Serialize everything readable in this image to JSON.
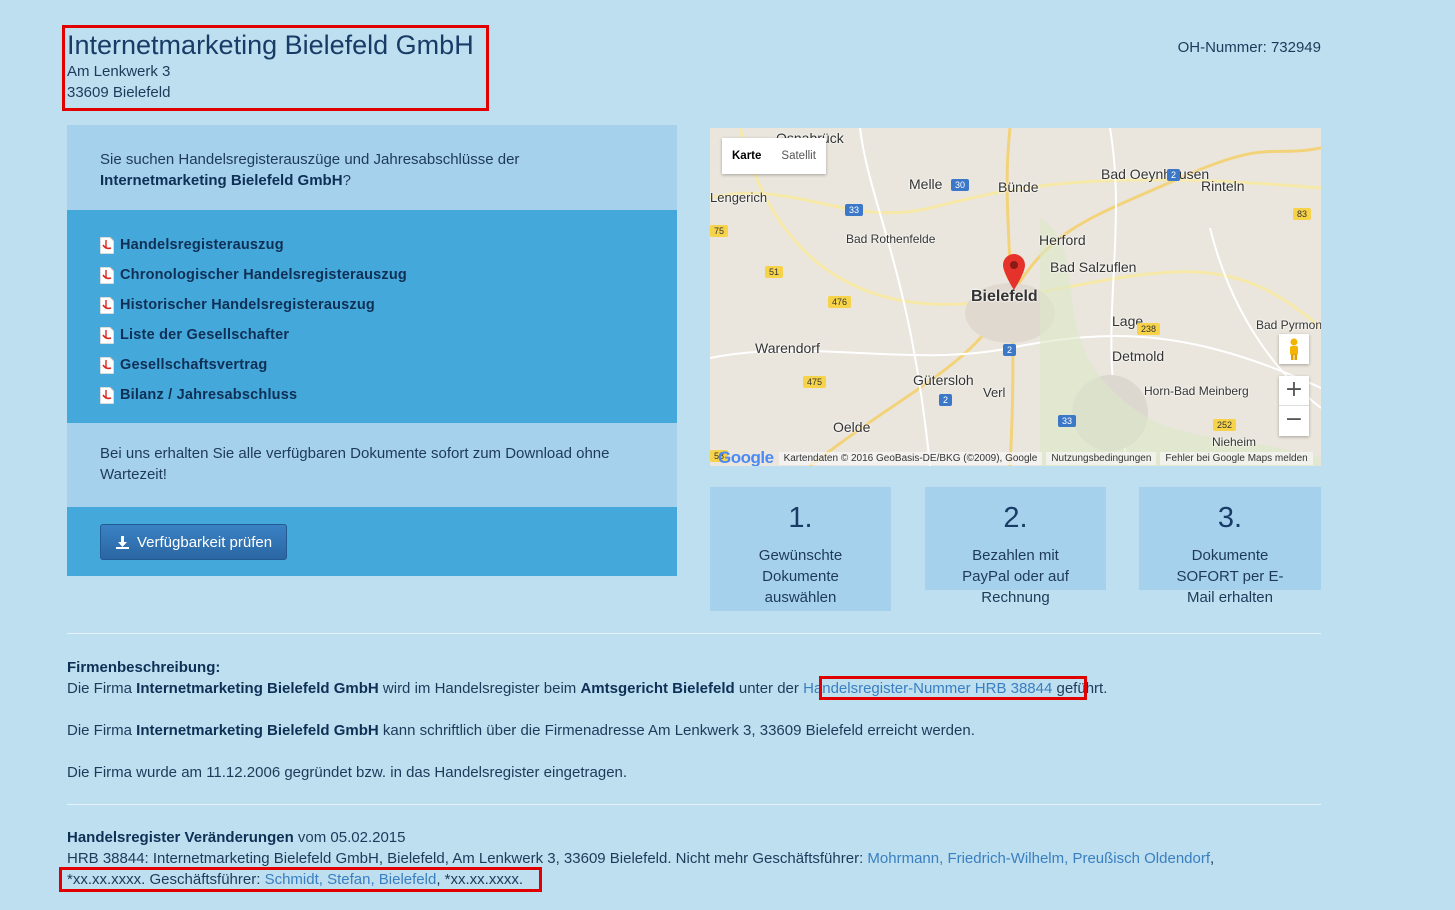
{
  "company": {
    "name": "Internetmarketing Bielefeld GmbH",
    "street": "Am Lenkwerk 3",
    "city": "33609 Bielefeld"
  },
  "oh_number": "OH-Nummer: 732949",
  "left_panel": {
    "intro_prefix": "Sie suchen Handelsregisterauszüge und Jahresabschlüsse der",
    "intro_company": "Internetmarketing Bielefeld GmbH",
    "intro_suffix": "?",
    "documents": [
      "Handelsregisterauszug",
      "Chronologischer Handelsregisterauszug",
      "Historischer Handelsregisterauszug",
      "Liste der Gesellschafter",
      "Gesellschaftsvertrag",
      "Bilanz / Jahresabschluss"
    ],
    "note": "Bei uns erhalten Sie alle verfügbaren Dokumente sofort zum Download ohne Wartezeit!",
    "button": "Verfügbarkeit prüfen"
  },
  "map": {
    "type_karte": "Karte",
    "type_satellit": "Satellit",
    "zoom_in": "+",
    "zoom_out": "−",
    "logo": "Google",
    "attribution": "Kartendaten © 2016 GeoBasis-DE/BKG (©2009), Google",
    "terms": "Nutzungsbedingungen",
    "report": "Fehler bei Google Maps melden",
    "places": [
      "Osnabrück",
      "Melle",
      "Bünde",
      "Bad Oeynhausen",
      "Rinteln",
      "Lengerich",
      "Bad Rothenfelde",
      "Herford",
      "Bad Salzuflen",
      "Bielefeld",
      "Lage",
      "Bad Pyrmont",
      "Warendorf",
      "Detmold",
      "Gütersloh",
      "Verl",
      "Horn-Bad Meinberg",
      "Oelde",
      "Nieheim"
    ],
    "roads": [
      "30",
      "2",
      "33",
      "83",
      "75",
      "51",
      "476",
      "238",
      "2",
      "475",
      "2",
      "33",
      "252",
      "58"
    ]
  },
  "steps": [
    {
      "num": "1.",
      "text": "Gewünschte Dokumente auswählen"
    },
    {
      "num": "2.",
      "text": "Bezahlen mit PayPal oder auf Rechnung"
    },
    {
      "num": "3.",
      "text": "Dokumente SOFORT per E-Mail erhalten"
    }
  ],
  "description": {
    "heading": "Firmenbeschreibung:",
    "p1_a": "Die Firma ",
    "p1_company": "Internetmarketing Bielefeld GmbH",
    "p1_b": " wird im Handelsregister beim ",
    "p1_court": "Amtsgericht Bielefeld",
    "p1_c": " unter der ",
    "p1_link": "Handelsregister-Nummer HRB 38844",
    "p1_d": " geführt.",
    "p2_a": "Die Firma ",
    "p2_company": "Internetmarketing Bielefeld GmbH",
    "p2_b": " kann schriftlich über die Firmenadresse Am Lenkwerk 3, 33609 Bielefeld erreicht werden.",
    "p3": "Die Firma wurde am 11.12.2006 gegründet bzw. in das Handelsregister eingetragen."
  },
  "history": {
    "heading": "Handelsregister Veränderungen",
    "date": " vom 05.02.2015",
    "line1": "HRB 38844: Internetmarketing Bielefeld GmbH, Bielefeld, Am Lenkwerk 3, 33609 Bielefeld. Nicht mehr Geschäftsführer: ",
    "person1": "Mohrmann, Friedrich-Wilhelm, Preußisch Oldendorf",
    "line2_a": ",",
    "line2_b": "*xx.xx.xxxx. Geschäftsführer: ",
    "person2": "Schmidt, Stefan, Bielefeld",
    "line2_c": ", *xx.xx.xxxx."
  },
  "colors": {
    "background": "#bddff0",
    "panel_light": "#a5d1ec",
    "panel_dark": "#45a8db",
    "button": "#2a66a3",
    "highlight_box": "#e00000",
    "link": "#3a7fc0"
  }
}
